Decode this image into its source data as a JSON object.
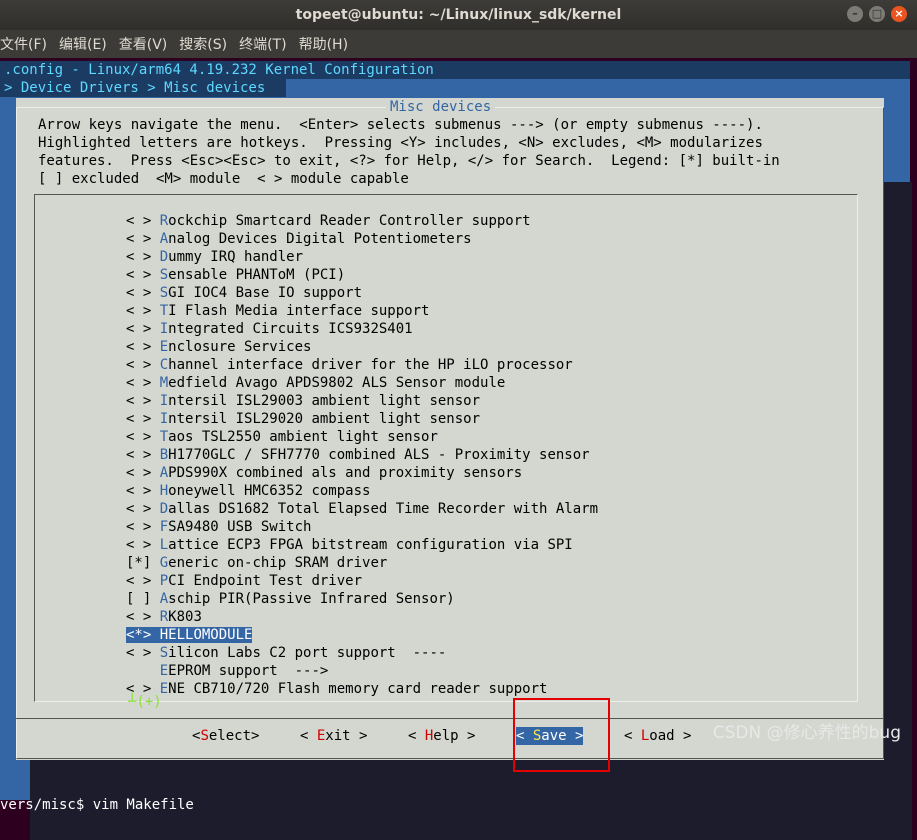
{
  "window": {
    "title": "topeet@ubuntu: ~/Linux/linux_sdk/kernel",
    "buttons": [
      "–",
      "□",
      "×"
    ]
  },
  "menubar": [
    "文件(F)",
    "编辑(E)",
    "查看(V)",
    "搜索(S)",
    "终端(T)",
    "帮助(H)"
  ],
  "config_title": ".config - Linux/arm64 4.19.232 Kernel Configuration",
  "breadcrumb": "> Device Drivers > Misc devices",
  "dialog": {
    "title": "Misc devices",
    "help_lines": [
      "Arrow keys navigate the menu.  <Enter> selects submenus ---> (or empty submenus ----).",
      "Highlighted letters are hotkeys.  Pressing <Y> includes, <N> excludes, <M> modularizes",
      "features.  Press <Esc><Esc> to exit, <?> for Help, </> for Search.  Legend: [*] built-in",
      "[ ] excluded  <M> module  < > module capable"
    ],
    "entries": [
      {
        "mark": "< > ",
        "hot": "R",
        "rest": "ockchip Smartcard Reader Controller support"
      },
      {
        "mark": "< > ",
        "hot": "A",
        "rest": "nalog Devices Digital Potentiometers"
      },
      {
        "mark": "< > ",
        "hot": "D",
        "rest": "ummy IRQ handler"
      },
      {
        "mark": "< > ",
        "hot": "S",
        "rest": "ensable PHANToM (PCI)"
      },
      {
        "mark": "< > ",
        "hot": "S",
        "rest": "GI IOC4 Base IO support"
      },
      {
        "mark": "< > ",
        "hot": "T",
        "rest": "I Flash Media interface support"
      },
      {
        "mark": "< > ",
        "hot": "I",
        "rest": "ntegrated Circuits ICS932S401"
      },
      {
        "mark": "< > ",
        "hot": "E",
        "rest": "nclosure Services"
      },
      {
        "mark": "< > ",
        "hot": "C",
        "rest": "hannel interface driver for the HP iLO processor"
      },
      {
        "mark": "< > ",
        "hot": "M",
        "rest": "edfield Avago APDS9802 ALS Sensor module"
      },
      {
        "mark": "< > ",
        "hot": "I",
        "rest": "ntersil ISL29003 ambient light sensor"
      },
      {
        "mark": "< > ",
        "hot": "I",
        "rest": "ntersil ISL29020 ambient light sensor"
      },
      {
        "mark": "< > ",
        "hot": "T",
        "rest": "aos TSL2550 ambient light sensor"
      },
      {
        "mark": "< > ",
        "hot": "B",
        "rest": "H1770GLC / SFH7770 combined ALS - Proximity sensor"
      },
      {
        "mark": "< > ",
        "hot": "A",
        "rest": "PDS990X combined als and proximity sensors"
      },
      {
        "mark": "< > ",
        "hot": "H",
        "rest": "oneywell HMC6352 compass"
      },
      {
        "mark": "< > ",
        "hot": "D",
        "rest": "allas DS1682 Total Elapsed Time Recorder with Alarm"
      },
      {
        "mark": "< > ",
        "hot": "F",
        "rest": "SA9480 USB Switch"
      },
      {
        "mark": "< > ",
        "hot": "L",
        "rest": "attice ECP3 FPGA bitstream configuration via SPI"
      },
      {
        "mark": "[*] ",
        "hot": "G",
        "rest": "eneric on-chip SRAM driver"
      },
      {
        "mark": "< > ",
        "hot": "P",
        "rest": "CI Endpoint Test driver"
      },
      {
        "mark": "[ ] ",
        "hot": "A",
        "rest": "schip PIR(Passive Infrared Sensor)"
      },
      {
        "mark": "< > ",
        "hot": "R",
        "rest": "K803"
      },
      {
        "mark": "<*> ",
        "hot": "H",
        "rest": "ELLOMODULE",
        "selected": true
      },
      {
        "mark": "< > ",
        "hot": "S",
        "rest": "ilicon Labs C2 port support  ----"
      },
      {
        "mark": "    ",
        "hot": "E",
        "rest": "EPROM support  --->"
      },
      {
        "mark": "< > ",
        "hot": "E",
        "rest": "NE CB710/720 Flash memory card reader support"
      }
    ],
    "more_indicator": "┴(+)",
    "buttons": [
      {
        "pre": "<",
        "hot": "S",
        "post": "elect>",
        "active": false
      },
      {
        "pre": "< ",
        "hot": "E",
        "post": "xit >",
        "active": false
      },
      {
        "pre": "< ",
        "hot": "H",
        "post": "elp >",
        "active": false
      },
      {
        "pre": "< ",
        "hot": "S",
        "post": "ave >",
        "active": true
      },
      {
        "pre": "< ",
        "hot": "L",
        "post": "oad >",
        "active": false
      }
    ]
  },
  "prompt": "vers/misc$ vim Makefile",
  "watermark": "CSDN @修心养性的bug",
  "colors": {
    "terminal_bg": "#2c001e",
    "dialog_bg": "#d3d7cf",
    "accent": "#3465a4",
    "annotation": "#e30000"
  }
}
